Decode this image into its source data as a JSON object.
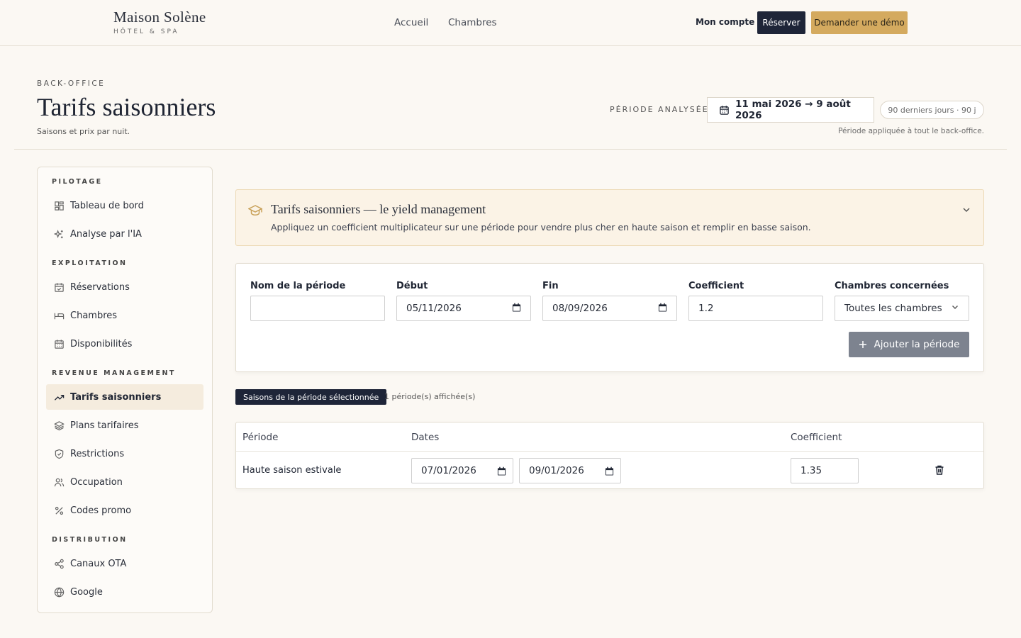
{
  "brand": {
    "name": "Maison Solène",
    "tagline": "HÔTEL & SPA"
  },
  "topnav": [
    {
      "label": "Accueil"
    },
    {
      "label": "Chambres"
    }
  ],
  "header_actions": {
    "account": "Mon compte",
    "book": "Réserver",
    "demo": "Demander une démo"
  },
  "page": {
    "eyebrow": "BACK-OFFICE",
    "title": "Tarifs saisonniers",
    "subtitle": "Saisons et prix par nuit.",
    "period_label": "PÉRIODE ANALYSÉE",
    "period_range": "11 mai 2026 → 9 août 2026",
    "period_pill": "90 derniers jours · 90 j",
    "period_note": "Période appliquée à tout le back-office."
  },
  "sidebar": {
    "sections": [
      {
        "title": "PILOTAGE",
        "items": [
          {
            "label": "Tableau de bord",
            "icon": "dashboard-icon"
          },
          {
            "label": "Analyse par l'IA",
            "icon": "sparkles-icon"
          }
        ]
      },
      {
        "title": "EXPLOITATION",
        "items": [
          {
            "label": "Réservations",
            "icon": "calendar-check-icon"
          },
          {
            "label": "Chambres",
            "icon": "bed-icon"
          },
          {
            "label": "Disponibilités",
            "icon": "calendar-grid-icon"
          }
        ]
      },
      {
        "title": "REVENUE MANAGEMENT",
        "items": [
          {
            "label": "Tarifs saisonniers",
            "icon": "trending-up-icon",
            "active": true
          },
          {
            "label": "Plans tarifaires",
            "icon": "layers-icon"
          },
          {
            "label": "Restrictions",
            "icon": "shield-icon"
          },
          {
            "label": "Occupation",
            "icon": "users-icon"
          },
          {
            "label": "Codes promo",
            "icon": "percent-icon"
          }
        ]
      },
      {
        "title": "DISTRIBUTION",
        "items": [
          {
            "label": "Canaux OTA",
            "icon": "share-icon"
          },
          {
            "label": "Google",
            "icon": "globe-icon"
          }
        ]
      }
    ]
  },
  "info": {
    "title": "Tarifs saisonniers — le yield management",
    "text": "Appliquez un coefficient multiplicateur sur une période pour vendre plus cher en haute saison et remplir en basse saison."
  },
  "form": {
    "name_label": "Nom de la période",
    "name_value": "",
    "start_label": "Début",
    "start_value": "05/11/2026",
    "end_label": "Fin",
    "end_value": "08/09/2026",
    "coef_label": "Coefficient",
    "coef_value": "1.2",
    "rooms_label": "Chambres concernées",
    "rooms_value": "Toutes les chambres",
    "add_button": "Ajouter la période"
  },
  "list": {
    "badge": "Saisons de la période sélectionnée",
    "count": "1 période(s) affichée(s)"
  },
  "table": {
    "headers": {
      "period": "Période",
      "dates": "Dates",
      "coef": "Coefficient"
    },
    "rows": [
      {
        "name": "Haute saison estivale",
        "start": "07/01/2026",
        "end": "09/01/2026",
        "coef": "1.35"
      }
    ]
  },
  "colors": {
    "accent": "#d4aa5f",
    "navy": "#1e2538",
    "background": "#fbf8f3"
  }
}
